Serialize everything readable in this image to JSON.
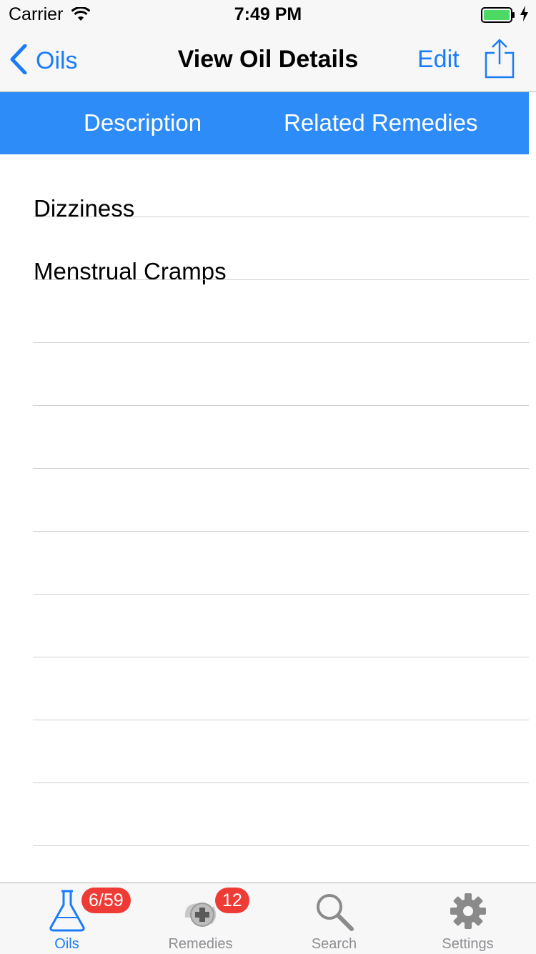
{
  "status_bar": {
    "carrier": "Carrier",
    "time": "7:49 PM",
    "battery_color": "#4cd964"
  },
  "nav_bar": {
    "back_label": "Oils",
    "title": "View Oil Details",
    "edit_label": "Edit",
    "share_icon": "share-icon",
    "accent_color": "#1a7cf6"
  },
  "segments": {
    "description_label": "Description",
    "related_label": "Related Remedies",
    "background_color": "#2d8cf7"
  },
  "remedies": [
    {
      "label": "Dizziness"
    },
    {
      "label": "Menstrual Cramps"
    },
    {
      "label": ""
    },
    {
      "label": ""
    },
    {
      "label": ""
    },
    {
      "label": ""
    },
    {
      "label": ""
    },
    {
      "label": ""
    },
    {
      "label": ""
    },
    {
      "label": ""
    },
    {
      "label": ""
    },
    {
      "label": ""
    }
  ],
  "tab_bar": {
    "tabs": [
      {
        "label": "Oils",
        "icon": "flask-icon",
        "badge": "6/59",
        "active": true
      },
      {
        "label": "Remedies",
        "icon": "remedies-icon",
        "badge": "12",
        "active": false
      },
      {
        "label": "Search",
        "icon": "search-icon",
        "badge": "",
        "active": false
      },
      {
        "label": "Settings",
        "icon": "gear-icon",
        "badge": "",
        "active": false
      }
    ]
  }
}
